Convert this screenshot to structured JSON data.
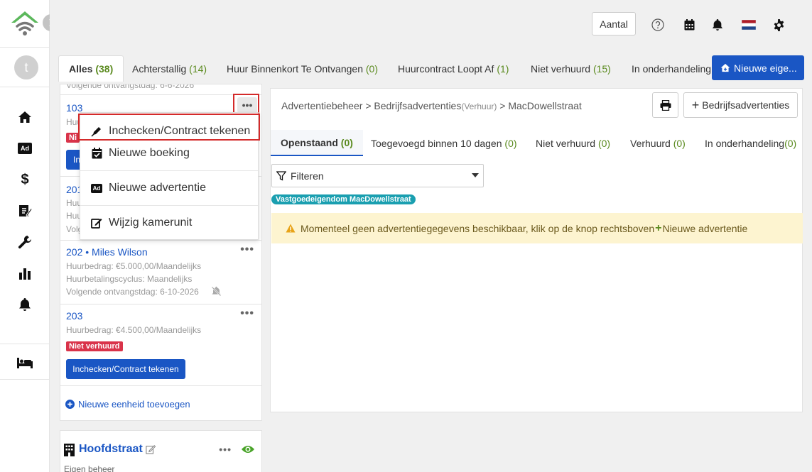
{
  "sidebar": {
    "avatar_letter": "t",
    "items": [
      {
        "icon": "home-icon"
      },
      {
        "icon": "ad-icon",
        "label": "Ad"
      },
      {
        "icon": "dollar-icon",
        "label": "$"
      },
      {
        "icon": "contract-icon"
      },
      {
        "icon": "wrench-icon"
      },
      {
        "icon": "bar-chart-icon"
      },
      {
        "icon": "bell-icon"
      },
      {
        "icon": "bed-icon"
      }
    ]
  },
  "topbar": {
    "aantal_label": "Aantal"
  },
  "tabs": [
    {
      "label": "Alles",
      "count": "(38)"
    },
    {
      "label": "Achterstallig",
      "count": "(14)"
    },
    {
      "label": "Huur Binnenkort Te Ontvangen",
      "count": "(0)"
    },
    {
      "label": "Huurcontract Loopt Af",
      "count": "(1)"
    },
    {
      "label": "Niet verhuurd",
      "count": "(15)"
    },
    {
      "label": "In onderhandeling",
      "count": ""
    }
  ],
  "new_property_button": "Nieuwe eige...",
  "units": {
    "top_cut_text": "Volgende ontvangstdag: 6-6-2026",
    "u103": {
      "title": "103",
      "line1": "Huu",
      "badge": "Ni",
      "button": "In"
    },
    "u201": {
      "title": "201",
      "line1": "Huu",
      "line2": "Huu",
      "line3": "Volg"
    },
    "u202": {
      "title": "202 • Miles Wilson",
      "line1": "Huurbedrag: €5.000,00/Maandelijks",
      "line2": "Huurbetalingscyclus: Maandelijks",
      "line3": "Volgende ontvangstdag:  6-10-2026"
    },
    "u203": {
      "title": "203",
      "line1": "Huurbedrag: €4.500,00/Maandelijks",
      "badge": "Niet verhuurd",
      "button": "Inchecken/Contract tekenen"
    },
    "add_unit": "Nieuwe eenheid toevoegen"
  },
  "property": {
    "name": "Hoofdstraat",
    "management": "Eigen beheer"
  },
  "context_menu": {
    "items": [
      {
        "label": "Inchecken/Contract tekenen",
        "icon": "pen-icon"
      },
      {
        "label": "Nieuwe boeking",
        "icon": "calendar-check-icon"
      },
      {
        "label": "Nieuwe advertentie",
        "icon": "ad-icon",
        "icon_text": "Ad"
      },
      {
        "label": "Wijzig kamerunit",
        "icon": "edit-icon"
      }
    ]
  },
  "main": {
    "breadcrumb": {
      "part1": "Advertentiebeheer",
      "sep": ">",
      "part2": "Bedrijfsadvertenties",
      "part2_sub": "(Verhuur)",
      "part3": "MacDowellstraat"
    },
    "bedrijf_button": "Bedrijfsadvertenties",
    "subtabs": [
      {
        "label": "Openstaand",
        "count": "(0)"
      },
      {
        "label": "Toegevoegd binnen 10 dagen",
        "count": "(0)"
      },
      {
        "label": "Niet verhuurd",
        "count": "(0)"
      },
      {
        "label": "Verhuurd",
        "count": "(0)"
      },
      {
        "label": "In onderhandeling",
        "count": "(0)"
      }
    ],
    "filter_label": "Filteren",
    "tag": "Vastgoedeigendom MacDowellstraat",
    "warning_text": "Momenteel geen advertentiegegevens beschikbaar, klik op de knop rechtsboven",
    "warning_plus": "+",
    "warning_link": "Nieuwe advertentie"
  },
  "colors": {
    "primary": "#1a56c4",
    "count_green": "#5a8a1e",
    "danger": "#d9334a",
    "tag_teal": "#1a9fb0",
    "warning_bg": "#fdf4d0"
  }
}
